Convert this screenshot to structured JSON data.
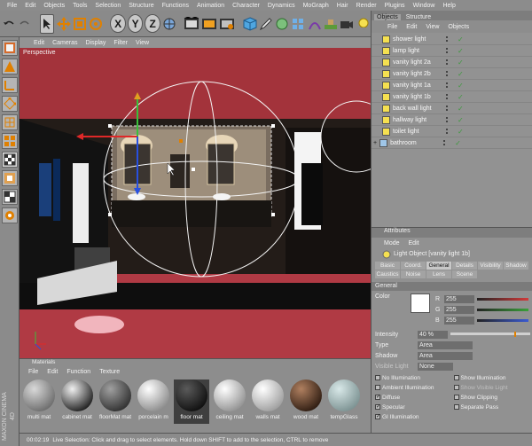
{
  "menubar": [
    "File",
    "Edit",
    "Objects",
    "Tools",
    "Selection",
    "Structure",
    "Functions",
    "Animation",
    "Character",
    "Dynamics",
    "MoGraph",
    "Hair",
    "Render",
    "Plugins",
    "Window",
    "Help"
  ],
  "toolbar": {
    "icons": [
      "undo-icon",
      "redo-icon",
      "select-arrow-icon",
      "move-icon",
      "scale-icon",
      "rotate-icon",
      "x-axis-icon",
      "y-axis-icon",
      "z-axis-icon",
      "world-coords-icon",
      "render-view-icon",
      "render-picture-icon",
      "render-settings-icon",
      "cube-icon",
      "pen-icon",
      "nurbs-icon",
      "array-icon",
      "deformer-icon",
      "scene-icon",
      "camera-icon",
      "light-icon"
    ],
    "glyphs": {
      "x": "X",
      "y": "Y",
      "z": "Z"
    }
  },
  "left_tools": [
    "model-icon",
    "texture-icon",
    "axis-icon",
    "points-icon",
    "edges-icon",
    "polygons-icon",
    "checker-icon",
    "snap-icon",
    "sculpt-icon",
    "uv-icon"
  ],
  "maxon_logo": "MAXON CINEMA 4D",
  "viewport": {
    "menu": [
      "Edit",
      "Cameras",
      "Display",
      "Filter",
      "View"
    ],
    "label": "Perspective"
  },
  "objects_panel": {
    "tabs": [
      "Objects",
      "Structure"
    ],
    "menu": [
      "File",
      "Edit",
      "View",
      "Objects"
    ],
    "items": [
      {
        "name": "shower light"
      },
      {
        "name": "lamp light"
      },
      {
        "name": "vanity light 2a"
      },
      {
        "name": "vanity light 2b"
      },
      {
        "name": "vanity light 1a"
      },
      {
        "name": "vanity light 1b"
      },
      {
        "name": "back wall light"
      },
      {
        "name": "hallway light"
      },
      {
        "name": "toilet light"
      },
      {
        "name": "bathroom"
      }
    ],
    "expand_glyph": "+"
  },
  "attributes_panel": {
    "title": "Attributes",
    "menu": [
      "Mode",
      "Edit"
    ],
    "object_title": "Light Object [vanity light 1b]",
    "tabs": [
      {
        "label": "Basic",
        "active": false
      },
      {
        "label": "Coord.",
        "active": false
      },
      {
        "label": "General",
        "active": true
      },
      {
        "label": "Details",
        "active": false
      },
      {
        "label": "Visibility",
        "active": false
      },
      {
        "label": "Shadow",
        "active": false
      },
      {
        "label": "Caustics",
        "active": false
      },
      {
        "label": "Noise",
        "active": false
      },
      {
        "label": "Lens",
        "active": false
      },
      {
        "label": "Scene",
        "active": false
      }
    ],
    "section": "General",
    "color_label": "Color",
    "rgb": [
      {
        "channel": "R",
        "value": "255",
        "color": "#d23a3a"
      },
      {
        "channel": "G",
        "value": "255",
        "color": "#3aa03a"
      },
      {
        "channel": "B",
        "value": "255",
        "color": "#3a5ad2"
      }
    ],
    "intensity_label": "Intensity",
    "intensity_value": "40 %",
    "type_label": "Type",
    "type_value": "Area",
    "shadow_label": "Shadow",
    "shadow_value": "Area",
    "visible_light_label": "Visible Light",
    "visible_light_value": "None",
    "checks": [
      {
        "label": "No Illumination",
        "checked": false,
        "dim": false
      },
      {
        "label": "Show Illumination",
        "checked": false,
        "dim": false
      },
      {
        "label": "Ambient Illumination",
        "checked": false,
        "dim": false
      },
      {
        "label": "Show Visible Light",
        "checked": false,
        "dim": true
      },
      {
        "label": "Diffuse",
        "checked": true,
        "dim": false
      },
      {
        "label": "Show Clipping",
        "checked": false,
        "dim": false
      },
      {
        "label": "Specular",
        "checked": true,
        "dim": false
      },
      {
        "label": "Separate Pass",
        "checked": false,
        "dim": false
      },
      {
        "label": "GI Illumination",
        "checked": true,
        "dim": false
      }
    ],
    "check_mark": "✓"
  },
  "materials_panel": {
    "title": "Materials",
    "menu": [
      "File",
      "Edit",
      "Function",
      "Texture"
    ],
    "items": [
      {
        "label": "multi mat",
        "base": "#d9d9d9",
        "dark": "#6a6a6a"
      },
      {
        "label": "cabinet mat",
        "base": "#f0f0f0",
        "dark": "#1a1a1a"
      },
      {
        "label": "floorMat mat",
        "base": "#a0a0a0",
        "dark": "#2e2e2e"
      },
      {
        "label": "porcelain m",
        "base": "#ffffff",
        "dark": "#8a8a8a"
      },
      {
        "label": "floor mat",
        "base": "#5a5a5a",
        "dark": "#0e0e0e"
      },
      {
        "label": "ceiling mat",
        "base": "#ffffff",
        "dark": "#909090"
      },
      {
        "label": "walls mat",
        "base": "#ffffff",
        "dark": "#9c9c9c"
      },
      {
        "label": "wood mat",
        "base": "#b08060",
        "dark": "#2b1a10"
      },
      {
        "label": "tempGlass",
        "base": "#d8e8e8",
        "dark": "#7a9090"
      }
    ]
  },
  "statusbar": {
    "time": "00:02:19",
    "message": "Live Selection: Click and drag to select elements. Hold down SHIFT to add to the selection, CTRL to remove"
  }
}
